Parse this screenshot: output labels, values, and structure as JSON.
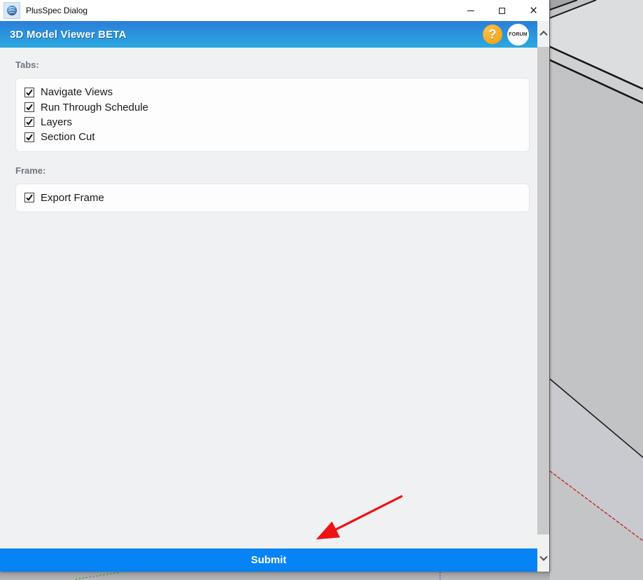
{
  "window": {
    "title": "PlusSpec Dialog",
    "controls": {
      "minimize": "minimize",
      "maximize": "maximize",
      "close": "close"
    }
  },
  "banner": {
    "title": "3D Model Viewer BETA",
    "help_label": "?",
    "forum_label": "FORUM"
  },
  "sections": [
    {
      "label": "Tabs:",
      "items": [
        {
          "label": "Navigate Views",
          "checked": true
        },
        {
          "label": "Run Through Schedule",
          "checked": true
        },
        {
          "label": "Layers",
          "checked": true
        },
        {
          "label": "Section Cut",
          "checked": true
        }
      ]
    },
    {
      "label": "Frame:",
      "items": [
        {
          "label": "Export Frame",
          "checked": true
        }
      ]
    }
  ],
  "submit": {
    "label": "Submit"
  },
  "colors": {
    "banner_top": "#2b7ed9",
    "banner_bottom": "#2ba9e0",
    "submit_blue": "#0683f5",
    "help_orange": "#f09c08",
    "annotation_arrow_red": "#ee1212",
    "body_background": "#f0f1f3",
    "viewport_gray": "#c6c7c9"
  }
}
